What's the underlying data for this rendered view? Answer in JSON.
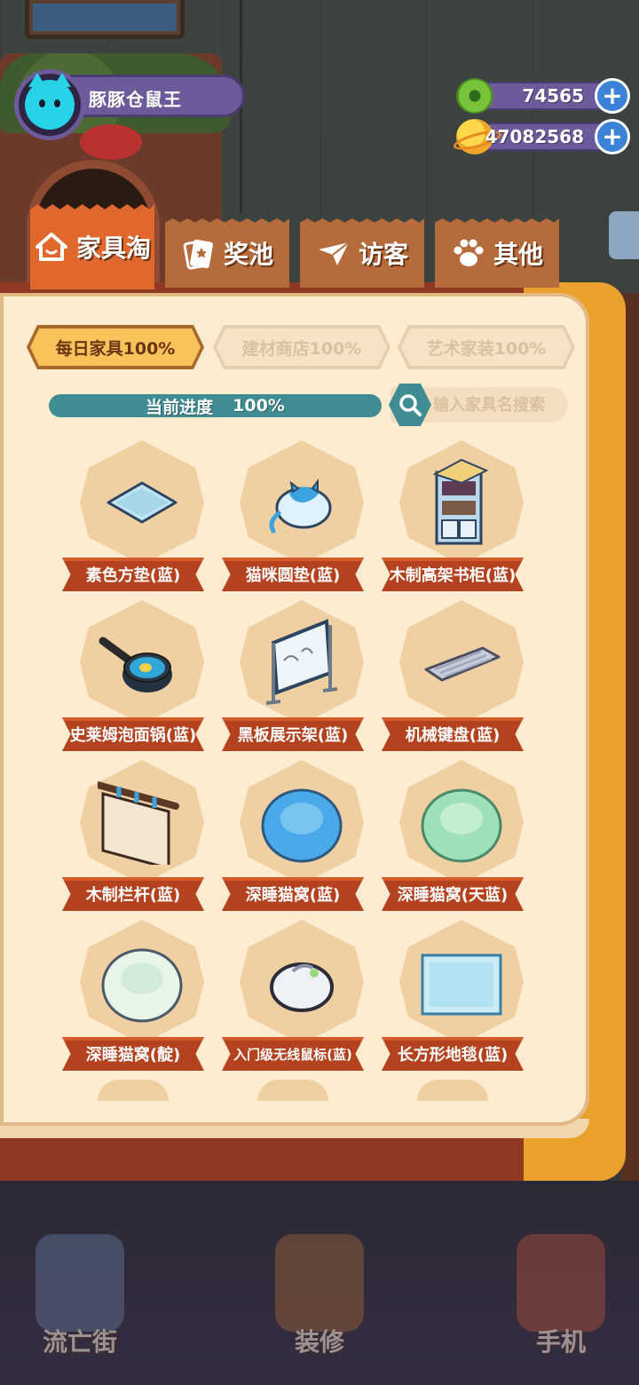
{
  "player": {
    "name": "豚豚仓鼠王"
  },
  "currency": [
    {
      "icon": "donut-coin-icon",
      "value": "74565"
    },
    {
      "icon": "planet-coin-icon",
      "value": "47082568"
    }
  ],
  "tabs": [
    {
      "label": "家具淘",
      "icon": "house-icon",
      "active": true
    },
    {
      "label": "奖池",
      "icon": "card-icon",
      "active": false
    },
    {
      "label": "访客",
      "icon": "paper-plane-icon",
      "active": false
    },
    {
      "label": "其他",
      "icon": "paw-icon",
      "active": false
    }
  ],
  "subtabs": [
    {
      "label": "每日家具100%",
      "active": true
    },
    {
      "label": "建材商店100%",
      "active": false
    },
    {
      "label": "艺术家装100%",
      "active": false
    }
  ],
  "progress": {
    "label": "当前进度",
    "percent_text": "100%",
    "value": 1.0
  },
  "search": {
    "placeholder": "输入家具名搜索"
  },
  "items": [
    {
      "name": "素色方垫(蓝)",
      "icon": "square-cushion-icon"
    },
    {
      "name": "猫咪圆垫(蓝)",
      "icon": "cat-cushion-icon"
    },
    {
      "name": "木制高架书柜(蓝)",
      "icon": "bookshelf-icon"
    },
    {
      "name": "史莱姆泡面锅(蓝)",
      "icon": "pot-icon"
    },
    {
      "name": "黑板展示架(蓝)",
      "icon": "board-stand-icon"
    },
    {
      "name": "机械键盘(蓝)",
      "icon": "keyboard-icon"
    },
    {
      "name": "木制栏杆(蓝)",
      "icon": "railing-icon"
    },
    {
      "name": "深睡猫窝(蓝)",
      "icon": "cat-bed-blue-icon"
    },
    {
      "name": "深睡猫窝(天蓝)",
      "icon": "cat-bed-skyblue-icon"
    },
    {
      "name": "深睡猫窝(靛)",
      "icon": "cat-bed-indigo-icon"
    },
    {
      "name": "入门级无线鼠标(蓝)",
      "icon": "mouse-icon"
    },
    {
      "name": "长方形地毯(蓝)",
      "icon": "rug-icon"
    }
  ],
  "bottom_nav": [
    {
      "label": "流亡街",
      "icon": "street-icon"
    },
    {
      "label": "装修",
      "icon": "paint-roller-icon"
    },
    {
      "label": "手机",
      "icon": "phone-icon"
    }
  ],
  "colors": {
    "accent_orange": "#e1682d",
    "tab_brown": "#b66b3a",
    "teal": "#3f8d93",
    "ribbon": "#b4421e",
    "page": "#fdecd0",
    "profile_purple": "#6c5a9a"
  }
}
